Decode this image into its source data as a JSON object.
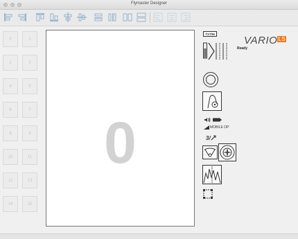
{
  "window": {
    "title": "Flymaster Designer"
  },
  "pages": [
    "0",
    "1",
    "2",
    "3",
    "4",
    "5",
    "6",
    "7",
    "8",
    "9",
    "10",
    "11",
    "12",
    "13",
    "14",
    "15"
  ],
  "canvas": {
    "page_number": "0"
  },
  "device": {
    "brand_main": "VARIO",
    "brand_suffix": "LS",
    "status": "Ready"
  },
  "palette": {
    "label_chip": "TXT/M",
    "mobile_label": "MOBILE OP",
    "wind_label": "3/"
  },
  "colors": {
    "brand_accent": "#f07a1e",
    "toolbar_icon": "#9bb3cc",
    "canvas_bg": "#ffffff"
  }
}
